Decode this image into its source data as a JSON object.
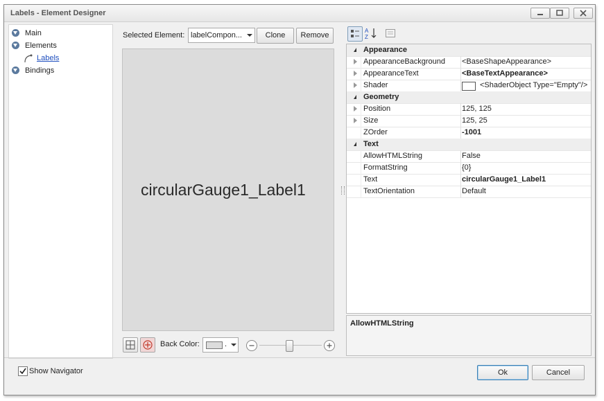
{
  "window": {
    "title": "Labels - Element Designer"
  },
  "navigator": {
    "items": [
      {
        "label": "Main"
      },
      {
        "label": "Elements"
      },
      {
        "label": "Labels"
      },
      {
        "label": "Bindings"
      }
    ]
  },
  "toolbar": {
    "selected_element_label": "Selected Element:",
    "selected_element_value": "labelCompon...",
    "clone_label": "Clone",
    "remove_label": "Remove"
  },
  "preview": {
    "text": "circularGauge1_Label1"
  },
  "bottom_bar": {
    "back_color_label": "Back Color:",
    "back_color_value": "."
  },
  "property_grid": {
    "categories": [
      {
        "name": "Appearance",
        "rows": [
          {
            "name": "AppearanceBackground",
            "value": "<BaseShapeAppearance>",
            "bold": false,
            "expandable": true
          },
          {
            "name": "AppearanceText",
            "value": "<BaseTextAppearance>",
            "bold": true,
            "expandable": true
          },
          {
            "name": "Shader",
            "value": "<ShaderObject Type=\"Empty\"/>",
            "bold": false,
            "expandable": true,
            "swatch": "#ffffff"
          }
        ]
      },
      {
        "name": "Geometry",
        "rows": [
          {
            "name": "Position",
            "value": "125, 125",
            "bold": false,
            "expandable": true
          },
          {
            "name": "Size",
            "value": "125, 25",
            "bold": false,
            "expandable": true
          },
          {
            "name": "ZOrder",
            "value": "-1001",
            "bold": true,
            "expandable": false
          }
        ]
      },
      {
        "name": "Text",
        "rows": [
          {
            "name": "AllowHTMLString",
            "value": "False",
            "bold": false,
            "expandable": false
          },
          {
            "name": "FormatString",
            "value": "{0}",
            "bold": false,
            "expandable": false
          },
          {
            "name": "Text",
            "value": "circularGauge1_Label1",
            "bold": true,
            "expandable": false
          },
          {
            "name": "TextOrientation",
            "value": "Default",
            "bold": false,
            "expandable": false
          }
        ]
      }
    ]
  },
  "description": {
    "title": "AllowHTMLString"
  },
  "footer": {
    "show_navigator_label": "Show Navigator",
    "show_navigator_checked": true,
    "ok_label": "Ok",
    "cancel_label": "Cancel"
  },
  "icons": {
    "minimize": "minimize-icon",
    "maximize": "maximize-icon",
    "close": "close-icon",
    "categorized": "categorized-icon",
    "alphabetical": "sort-az-icon",
    "property_pages": "property-pages-icon"
  },
  "colors": {
    "nav_bullet": "#5b7a9e",
    "link": "#1f4fbf",
    "canvas": "#dcdcdc"
  }
}
